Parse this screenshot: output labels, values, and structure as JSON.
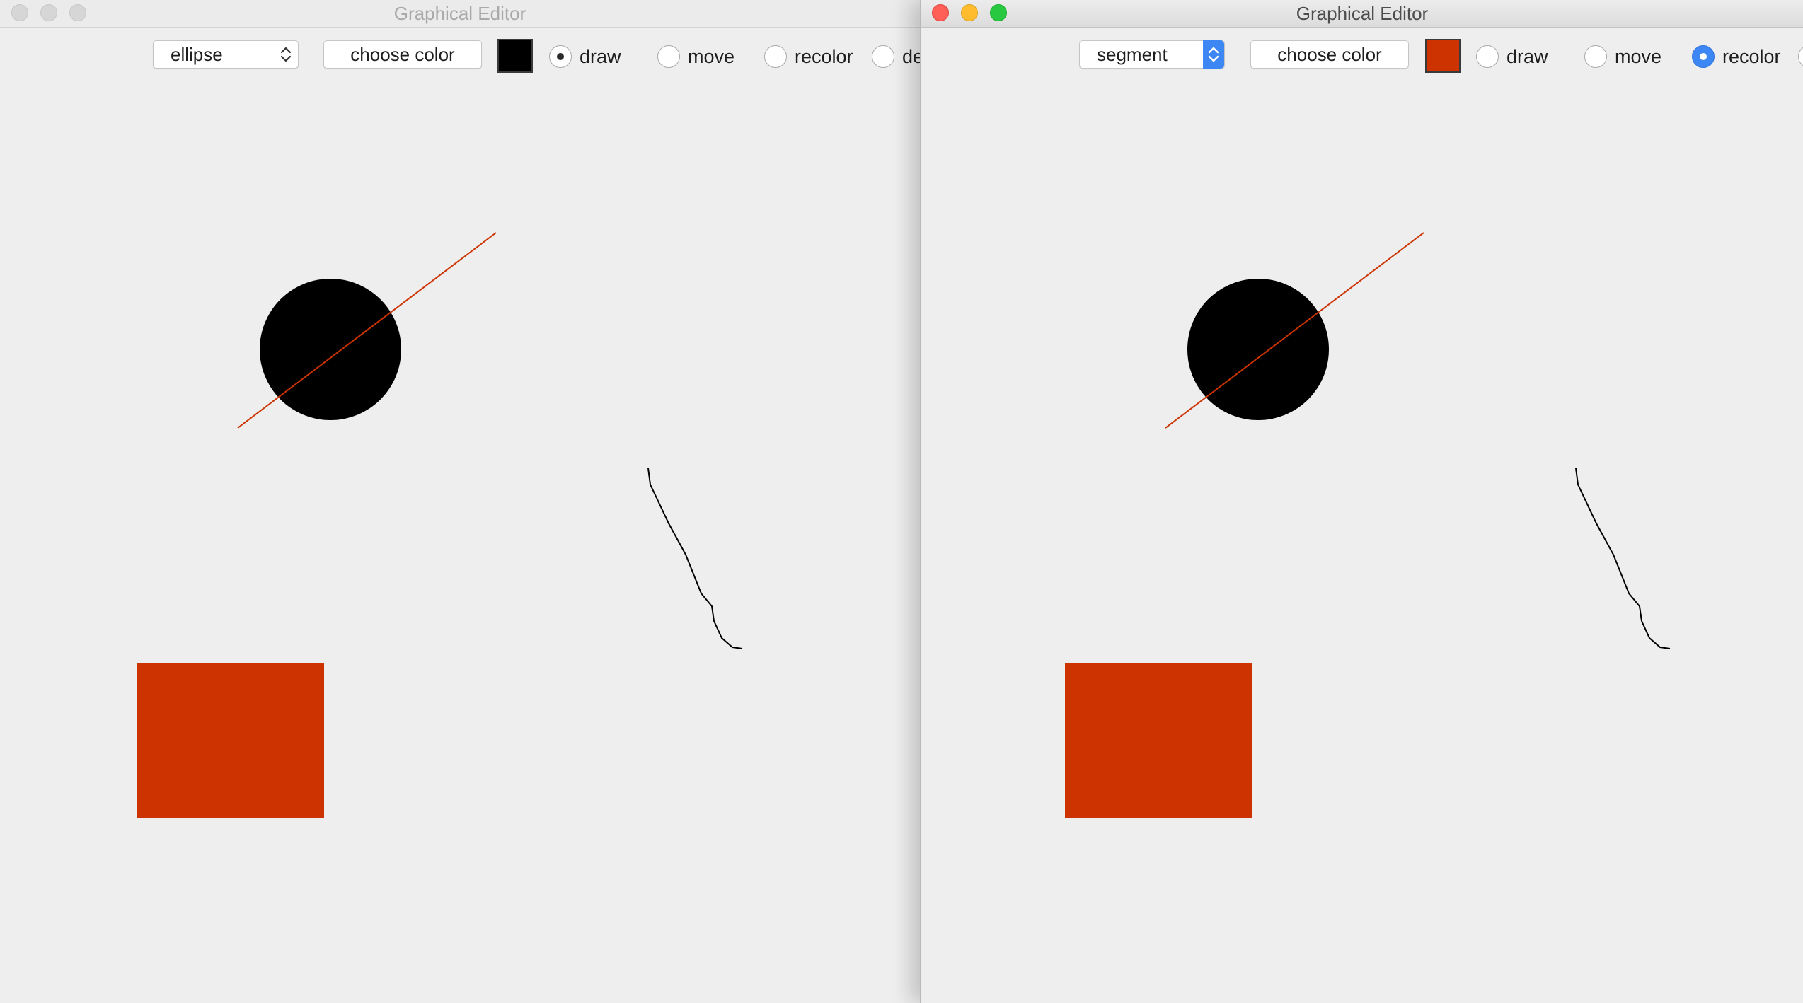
{
  "windows": [
    {
      "title": "Graphical Editor",
      "active": false,
      "shape_select": "ellipse",
      "choose_color_label": "choose color",
      "current_color": "#000000",
      "modes": [
        {
          "label": "draw",
          "checked": true
        },
        {
          "label": "move",
          "checked": false
        },
        {
          "label": "recolor",
          "checked": false
        },
        {
          "label": "de",
          "checked": false
        }
      ],
      "shapes": [
        {
          "type": "ellipse",
          "color": "#000000"
        },
        {
          "type": "segment",
          "color": "#cc3300"
        },
        {
          "type": "freehand",
          "color": "#000000"
        },
        {
          "type": "rectangle",
          "color": "#cc3300"
        }
      ]
    },
    {
      "title": "Graphical Editor",
      "active": true,
      "shape_select": "segment",
      "choose_color_label": "choose color",
      "current_color": "#cc3300",
      "modes": [
        {
          "label": "draw",
          "checked": false
        },
        {
          "label": "move",
          "checked": false
        },
        {
          "label": "recolor",
          "checked": true
        },
        {
          "label": "",
          "checked": false
        }
      ],
      "shapes": [
        {
          "type": "ellipse",
          "color": "#000000"
        },
        {
          "type": "segment",
          "color": "#cc3300"
        },
        {
          "type": "freehand",
          "color": "#000000"
        },
        {
          "type": "rectangle",
          "color": "#cc3300"
        }
      ]
    }
  ]
}
